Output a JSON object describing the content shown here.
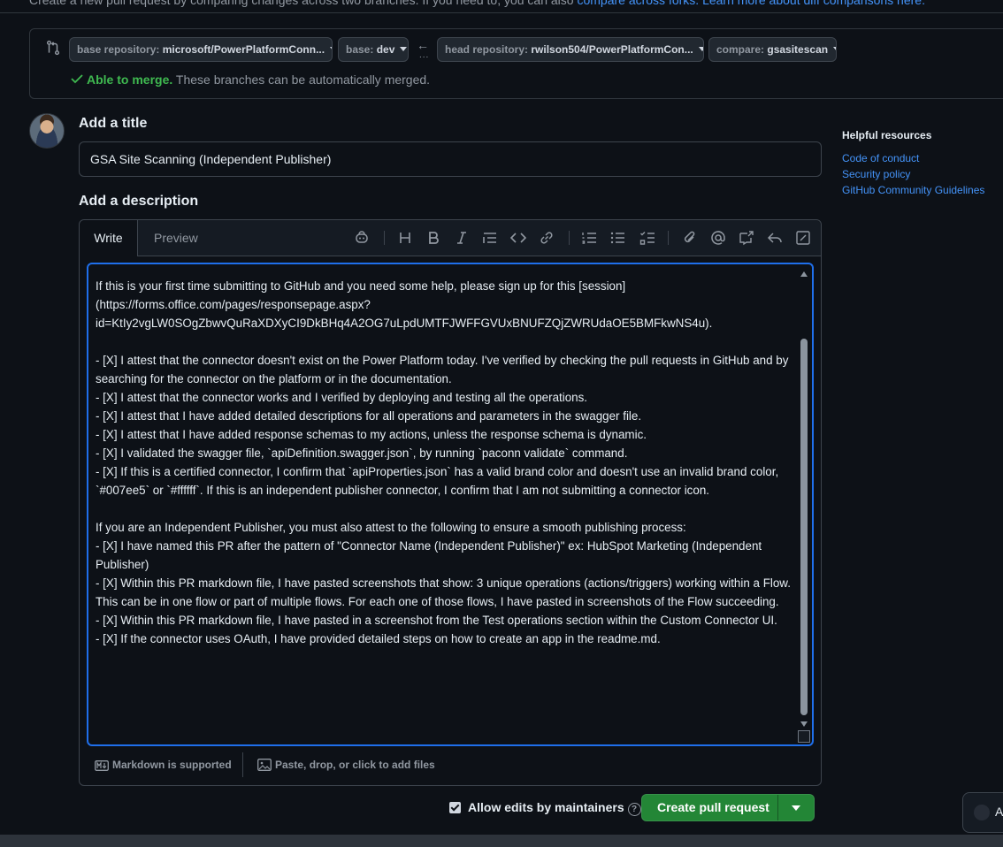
{
  "intro": {
    "text": "Create a new pull request by comparing changes across two branches. If you need to, you can also",
    "link1": "compare across forks.",
    "link2": "Learn more about diff comparisons here."
  },
  "compare": {
    "base_repo_key": "base repository:",
    "base_repo_val": "microsoft/PowerPlatformConn...",
    "base_key": "base:",
    "base_val": "dev",
    "arrow": "←",
    "arrow_dots": "...",
    "head_repo_key": "head repository:",
    "head_repo_val": "rwilson504/PowerPlatformCon...",
    "compare_key": "compare:",
    "compare_val": "gsasitescan",
    "merge_ok": "Able to merge.",
    "merge_text": "These branches can be automatically merged."
  },
  "form": {
    "title_heading": "Add a title",
    "title_value": "GSA Site Scanning (Independent Publisher)",
    "desc_heading": "Add a description",
    "tab_write": "Write",
    "tab_preview": "Preview",
    "body": "If this is your first time submitting to GitHub and you need some help, please sign up for this [session](https://forms.office.com/pages/responsepage.aspx?id=KtIy2vgLW0SOgZbwvQuRaXDXyCI9DkBHq4A2OG7uLpdUMTFJWFFGVUxBNUFZQjZWRUdaOE5BMFkwNS4u).\n\n- [X] I attest that the connector doesn't exist on the Power Platform today. I've verified by checking the pull requests in GitHub and by searching for the connector on the platform or in the documentation.\n- [X] I attest that the connector works and I verified by deploying and testing all the operations.\n- [X] I attest that I have added detailed descriptions for all operations and parameters in the swagger file.\n- [X] I attest that I have added response schemas to my actions, unless the response schema is dynamic.\n- [X] I validated the swagger file, `apiDefinition.swagger.json`, by running `paconn validate` command.\n- [X] If this is a certified connector, I confirm that `apiProperties.json` has a valid brand color and doesn't use an invalid brand color, `#007ee5` or `#ffffff`. If this is an independent publisher connector, I confirm that I am not submitting a connector icon.\n\nIf you are an Independent Publisher, you must also attest to the following to ensure a smooth publishing process:\n- [X] I have named this PR after the pattern of \"Connector Name (Independent Publisher)\" ex: HubSpot Marketing (Independent Publisher)\n- [X] Within this PR markdown file, I have pasted screenshots that show: 3 unique operations (actions/triggers) working within a Flow. This can be in one flow or part of multiple flows. For each one of those flows, I have pasted in screenshots of the Flow succeeding.\n- [X] Within this PR markdown file, I have pasted in a screenshot from the Test operations section within the Custom Connector UI.\n- [X] If the connector uses OAuth, I have provided detailed steps on how to create an app in the readme.md.",
    "markdown_note": "Markdown is supported",
    "attach_note": "Paste, drop, or click to add files",
    "allow_edits": "Allow edits by maintainers",
    "allow_edits_checked": true,
    "help_mark": "?",
    "create_button": "Create pull request"
  },
  "resources": {
    "heading": "Helpful resources",
    "links": [
      "Code of conduct",
      "Security policy",
      "GitHub Community Guidelines"
    ]
  },
  "copilot": {
    "label": "A"
  },
  "colors": {
    "accent": "#1f6feb",
    "link": "#4493f8",
    "primary_button": "#238636",
    "success": "#3fb950",
    "bg": "#0d1117"
  }
}
